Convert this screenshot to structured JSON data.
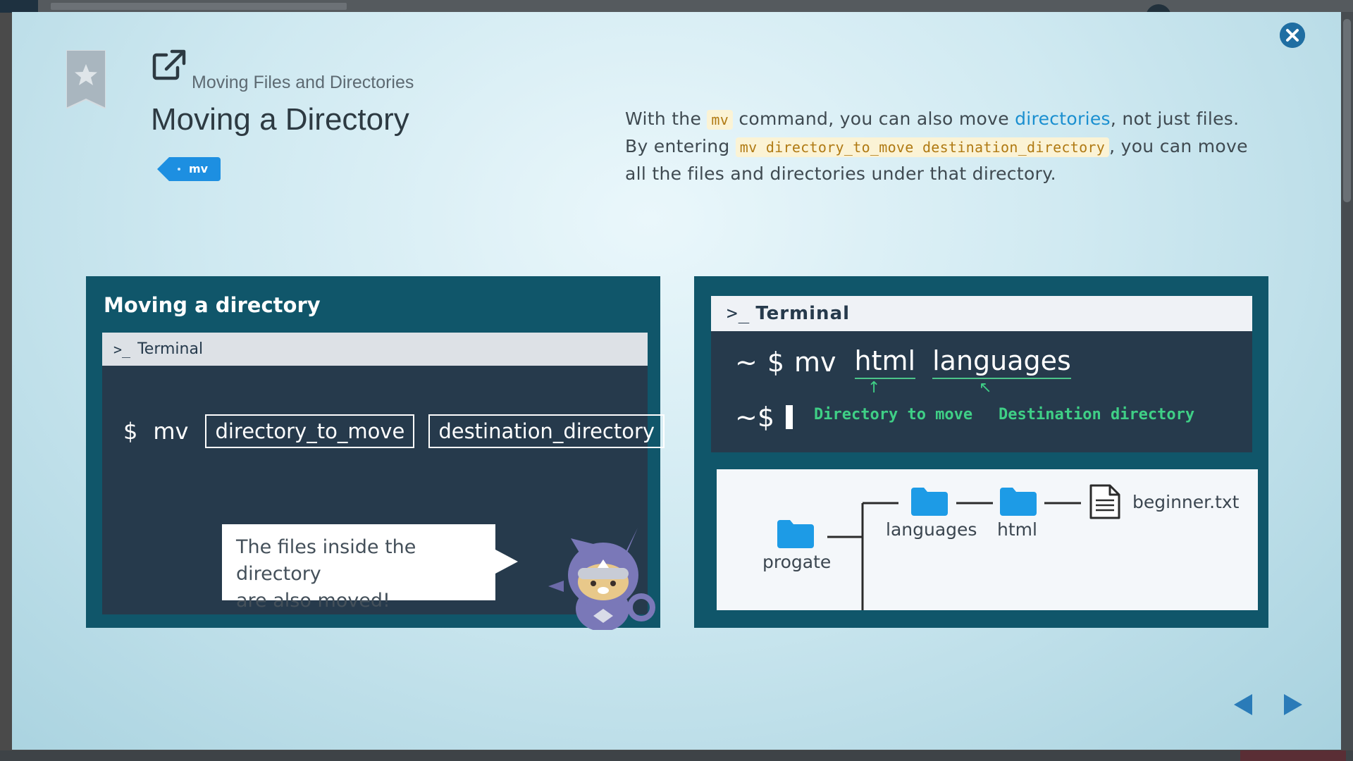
{
  "header": {
    "breadcrumb": "Moving Files and Directories",
    "title": "Moving a Directory",
    "tag": "mv"
  },
  "description": {
    "p1_pre": "With the ",
    "p1_code": "mv",
    "p1_mid": " command, you can also move ",
    "p1_link": "directories",
    "p1_post": ", not just files.",
    "p2_pre": "By entering ",
    "p2_code": "mv directory_to_move destination_directory",
    "p2_post": ", you can move",
    "p3": "all the files and directories under that directory."
  },
  "slide_left": {
    "title": "Moving a directory",
    "terminal_label": "Terminal",
    "prompt_symbol": ">_",
    "dollar": "$",
    "command": "mv",
    "arg1": "directory_to_move",
    "arg2": "destination_directory",
    "bubble_line1": "The files inside the directory",
    "bubble_line2": "are also moved!"
  },
  "slide_right": {
    "terminal_label": "Terminal",
    "prompt_symbol": ">_",
    "line1_tilde": "~",
    "line1_dollar": "$",
    "line1_cmd": "mv",
    "line1_arg1": "html",
    "line1_arg2": "languages",
    "line2_tilde": "~",
    "line2_dollar": "$",
    "label_move": "Directory to move",
    "label_dest": "Destination directory",
    "tree_root": "progate",
    "tree_dir1": "languages",
    "tree_dir2": "html",
    "tree_file": "beginner.txt"
  },
  "colors": {
    "accent": "#1d8fe1",
    "slide_bg": "#10566a",
    "terminal_bg": "#263a4c",
    "highlight_green": "#3fcf86",
    "folder": "#1d9be6",
    "code_text": "#b07a13"
  },
  "icons": {
    "close": "close-icon",
    "bookmark": "bookmark-star-icon",
    "external": "external-link-icon",
    "prev": "triangle-left-icon",
    "next": "triangle-right-icon"
  }
}
